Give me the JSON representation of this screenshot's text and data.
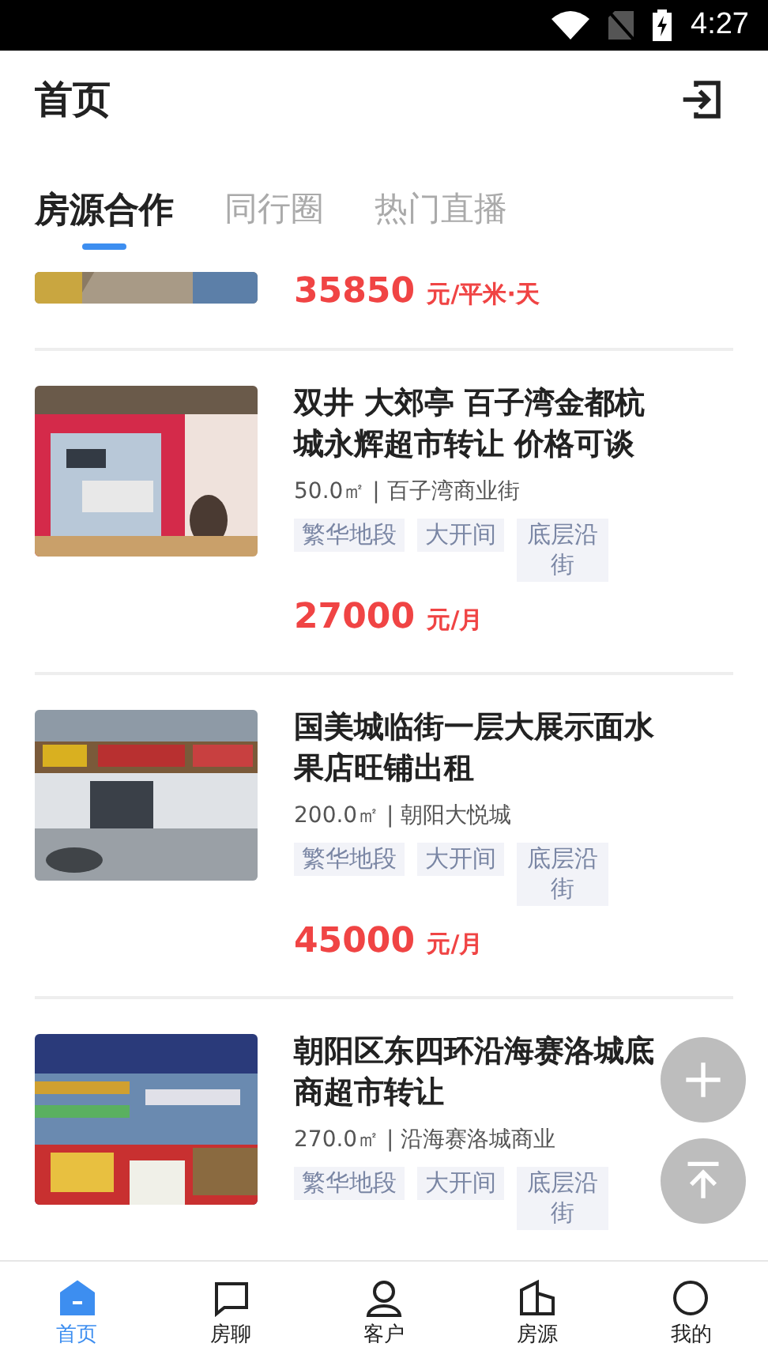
{
  "status_bar": {
    "time": "4:27"
  },
  "header": {
    "title": "首页"
  },
  "tabs": [
    {
      "label": "房源合作",
      "selected": true
    },
    {
      "label": "同行圈",
      "selected": false
    },
    {
      "label": "热门直播",
      "selected": false
    }
  ],
  "listings": [
    {
      "kind": "partial",
      "picture": {
        "kind": "picture"
      },
      "price": "35850",
      "unit": "元/平米·天"
    },
    {
      "kind": "full",
      "picture": {
        "kind": "picture"
      },
      "title": "双井 大郊亭 百子湾金都杭城永辉超市转让 价格可谈",
      "meta": "50.0㎡ | 百子湾商业街",
      "tags": [
        "繁华地段",
        "大开间",
        "底层沿街"
      ],
      "price": "27000",
      "unit": "元/月"
    },
    {
      "kind": "full",
      "picture": {
        "kind": "picture"
      },
      "title": "国美城临街一层大展示面水果店旺铺出租",
      "meta": "200.0㎡ | 朝阳大悦城",
      "tags": [
        "繁华地段",
        "大开间",
        "底层沿街"
      ],
      "price": "45000",
      "unit": "元/月"
    },
    {
      "kind": "full",
      "picture": {
        "kind": "picture"
      },
      "title": "朝阳区东四环沿海赛洛城底商超市转让",
      "meta": "270.0㎡ | 沿海赛洛城商业",
      "tags": [
        "繁华地段",
        "大开间",
        "底层沿街"
      ]
    }
  ],
  "nav": [
    {
      "label": "首页",
      "selected": true
    },
    {
      "label": "房聊",
      "selected": false
    },
    {
      "label": "客户",
      "selected": false
    },
    {
      "label": "房源",
      "selected": false
    },
    {
      "label": "我的",
      "selected": false
    }
  ]
}
